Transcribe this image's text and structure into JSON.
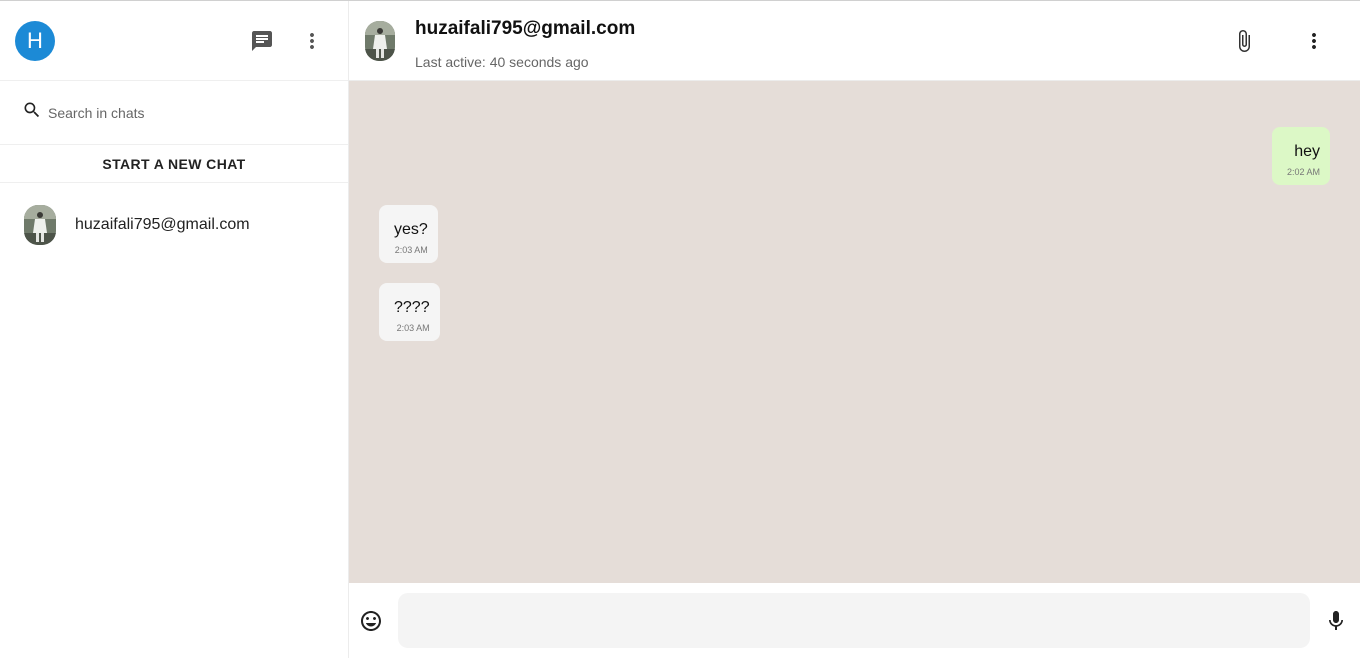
{
  "sidebar": {
    "user_initial": "H",
    "search_placeholder": "Search in chats",
    "new_chat_label": "START A NEW CHAT",
    "chats": [
      {
        "name": "huzaifali795@gmail.com"
      }
    ]
  },
  "chat": {
    "contact_name": "huzaifali795@gmail.com",
    "last_active": "Last active: 40 seconds ago",
    "messages": [
      {
        "text": "hey",
        "time": "2:02 AM",
        "direction": "sent"
      },
      {
        "text": "yes?",
        "time": "2:03 AM",
        "direction": "received"
      },
      {
        "text": "????",
        "time": "2:03 AM",
        "direction": "received"
      }
    ],
    "composer_placeholder": ""
  },
  "icons": {
    "new_chat": "chat-icon",
    "sidebar_menu": "more-vert-icon",
    "search": "search-icon",
    "attach": "paperclip-icon",
    "chat_menu": "more-vert-icon",
    "emoji": "emoji-icon",
    "mic": "mic-icon"
  },
  "colors": {
    "avatar": "#1c8ad6",
    "chat_background": "#e5ddd8",
    "sent_bubble": "#dcf8c6",
    "received_bubble": "#f5f5f5"
  }
}
